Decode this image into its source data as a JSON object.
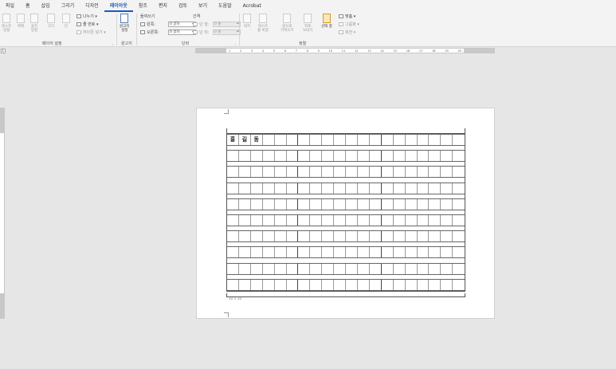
{
  "tabs": [
    "파일",
    "홈",
    "삽입",
    "그리기",
    "디자인",
    "레이아웃",
    "참조",
    "편지",
    "검토",
    "보기",
    "도움말",
    "Acrobat"
  ],
  "active_tab_index": 5,
  "ribbon": {
    "page_setup": {
      "label": "페이지 설정",
      "text_direction": "텍스트\n방향",
      "margins": "여백",
      "orientation": "용지\n방향",
      "size": "크기",
      "columns": "단",
      "breaks": "나누기",
      "line_numbers": "줄 번호",
      "hyphenation": "하이픈 넣기"
    },
    "manuscript": {
      "label": "원고지",
      "button": "원고지\n설정"
    },
    "paragraph": {
      "label": "단락",
      "indent_title": "들여쓰기",
      "spacing_title": "간격",
      "left_label": "왼쪽:",
      "left_value": "0 글자",
      "right_label": "오른쪽:",
      "right_value": "0 글자",
      "before_label": "단 앞:",
      "before_value": "0 줄",
      "after_label": "단 뒤:",
      "after_value": "0 줄"
    },
    "arrange": {
      "label": "정렬",
      "position": "위치",
      "wrap_text": "텍스트\n줄 바꿈",
      "bring_forward": "앞으로\n가져오기",
      "send_backward": "뒤로\n보내기",
      "selection_pane": "선택 창",
      "align": "맞춤",
      "group": "그룹화",
      "rotate": "회전"
    }
  },
  "ruler_numbers": [
    "1",
    "2",
    "3",
    "4",
    "5",
    "6",
    "7",
    "8",
    "9",
    "10",
    "11",
    "12",
    "13",
    "14",
    "15",
    "16",
    "17",
    "18",
    "19",
    "20"
  ],
  "document": {
    "first_row_chars": [
      "홍",
      "길",
      "동"
    ],
    "grid_rows": 10,
    "grid_cols": 20,
    "footer_label": "10 × 20"
  },
  "colors": {
    "accent": "#185abd",
    "background": "#e6e6e6"
  }
}
